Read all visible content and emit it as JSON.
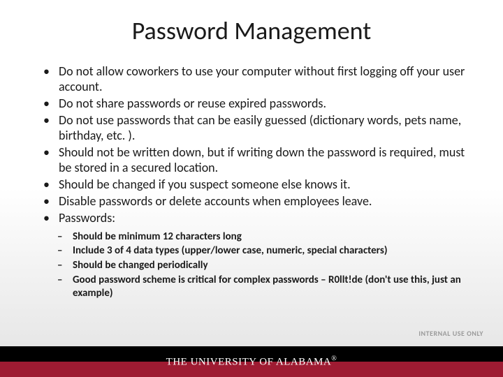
{
  "title": "Password Management",
  "bullets": [
    "Do not allow coworkers to use your computer without first logging off your user account.",
    "Do not share passwords or reuse expired passwords.",
    "Do not use passwords that can be easily guessed (dictionary words, pets name, birthday, etc. ).",
    "Should not be written down, but if writing down the password is required, must be stored in a secured location.",
    "Should be changed if you suspect someone else knows it.",
    "Disable passwords or delete accounts when employees leave.",
    "Passwords:"
  ],
  "sub_bullets": [
    "Should be minimum 12 characters long",
    "Include 3 of 4 data types (upper/lower case, numeric, special characters)",
    "Should be changed periodically",
    "Good password scheme is critical for complex passwords – R0llt!de (don't use this, just an example)"
  ],
  "confidential": "INTERNAL USE ONLY",
  "footer": {
    "org_name": "THE UNIVERSITY OF ALABAMA",
    "reg": "®"
  },
  "colors": {
    "crimson": "#9e1b32",
    "black": "#000000"
  }
}
